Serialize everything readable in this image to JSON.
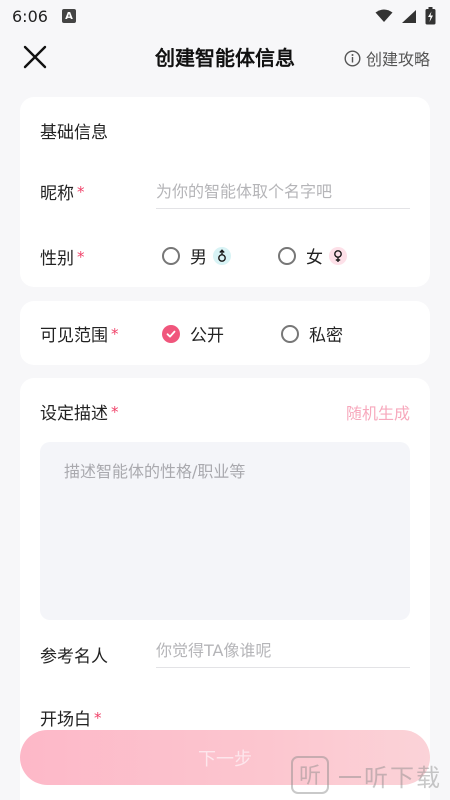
{
  "status_bar": {
    "time": "6:06",
    "notification_badge": "A"
  },
  "header": {
    "title": "创建智能体信息",
    "guide_label": "创建攻略"
  },
  "basic_info": {
    "section_title": "基础信息",
    "nickname": {
      "label": "昵称",
      "required_mark": "*",
      "placeholder": "为你的智能体取个名字吧",
      "value": ""
    },
    "gender": {
      "label": "性别",
      "required_mark": "*",
      "options": [
        {
          "label": "男",
          "icon": "male-icon",
          "selected": false
        },
        {
          "label": "女",
          "icon": "female-icon",
          "selected": false
        }
      ]
    }
  },
  "visibility": {
    "label": "可见范围",
    "required_mark": "*",
    "options": [
      {
        "label": "公开",
        "selected": true
      },
      {
        "label": "私密",
        "selected": false
      }
    ]
  },
  "setting": {
    "label": "设定描述",
    "required_mark": "*",
    "random_label": "随机生成",
    "placeholder": "描述智能体的性格/职业等",
    "value": ""
  },
  "reference": {
    "label": "参考名人",
    "placeholder": "你觉得TA像谁呢",
    "value": ""
  },
  "opening": {
    "label": "开场白",
    "required_mark": "*"
  },
  "next_button": {
    "label": "下一步"
  },
  "watermark": {
    "text": "一听下载",
    "logo_text": "听"
  },
  "colors": {
    "accent": "#f0567c",
    "required": "#f0436a",
    "random_link": "#f7a9bd",
    "button_gradient_start": "#fdb8c8",
    "button_gradient_end": "#fbd3d8"
  }
}
